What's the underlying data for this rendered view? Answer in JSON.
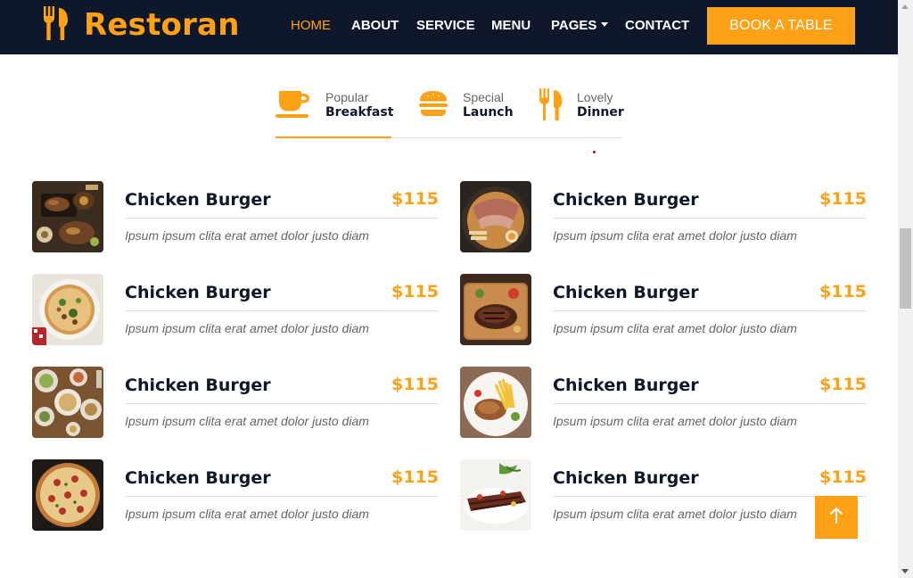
{
  "brand": {
    "name": "Restoran",
    "logo_icon": "utensils-icon",
    "color": "#fea116"
  },
  "nav": {
    "items": [
      {
        "label": "HOME",
        "active": true
      },
      {
        "label": "ABOUT"
      },
      {
        "label": "SERVICE"
      },
      {
        "label": "MENU"
      },
      {
        "label": "PAGES",
        "dropdown": true
      },
      {
        "label": "CONTACT"
      }
    ],
    "cta_label": "BOOK A TABLE"
  },
  "tabs": [
    {
      "small": "Popular",
      "big": "Breakfast",
      "icon": "coffee-icon",
      "active": true
    },
    {
      "small": "Special",
      "big": "Launch",
      "icon": "hamburger-icon"
    },
    {
      "small": "Lovely",
      "big": "Dinner",
      "icon": "utensils-icon"
    }
  ],
  "menu": {
    "items": [
      {
        "name": "Chicken Burger",
        "price": "$115",
        "description": "Ipsum ipsum clita erat amet dolor justo diam",
        "image": "grilled-platter-image"
      },
      {
        "name": "Chicken Burger",
        "price": "$115",
        "description": "Ipsum ipsum clita erat amet dolor justo diam",
        "image": "ramen-bowl-image"
      },
      {
        "name": "Chicken Burger",
        "price": "$115",
        "description": "Ipsum ipsum clita erat amet dolor justo diam",
        "image": "pizza-greens-image"
      },
      {
        "name": "Chicken Burger",
        "price": "$115",
        "description": "Ipsum ipsum clita erat amet dolor justo diam",
        "image": "steak-board-image"
      },
      {
        "name": "Chicken Burger",
        "price": "$115",
        "description": "Ipsum ipsum clita erat amet dolor justo diam",
        "image": "table-spread-image"
      },
      {
        "name": "Chicken Burger",
        "price": "$115",
        "description": "Ipsum ipsum clita erat amet dolor justo diam",
        "image": "steak-fries-image"
      },
      {
        "name": "Chicken Burger",
        "price": "$115",
        "description": "Ipsum ipsum clita erat amet dolor justo diam",
        "image": "pepperoni-pizza-image"
      },
      {
        "name": "Chicken Burger",
        "price": "$115",
        "description": "Ipsum ipsum clita erat amet dolor justo diam",
        "image": "sliced-beef-image"
      }
    ]
  },
  "back_to_top_icon": "arrow-up-icon",
  "colors": {
    "primary": "#fea116",
    "dark": "#0f172b",
    "muted": "#666565",
    "border": "#dee2e6"
  }
}
